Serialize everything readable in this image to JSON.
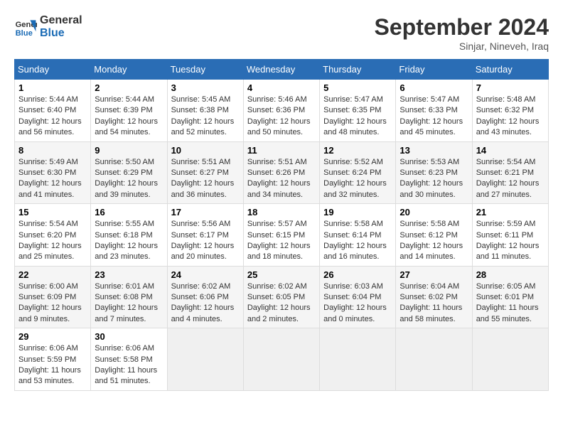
{
  "logo": {
    "line1": "General",
    "line2": "Blue"
  },
  "title": "September 2024",
  "location": "Sinjar, Nineveh, Iraq",
  "days_of_week": [
    "Sunday",
    "Monday",
    "Tuesday",
    "Wednesday",
    "Thursday",
    "Friday",
    "Saturday"
  ],
  "weeks": [
    [
      {
        "day": "1",
        "sunrise": "5:44 AM",
        "sunset": "6:40 PM",
        "daylight": "12 hours and 56 minutes."
      },
      {
        "day": "2",
        "sunrise": "5:44 AM",
        "sunset": "6:39 PM",
        "daylight": "12 hours and 54 minutes."
      },
      {
        "day": "3",
        "sunrise": "5:45 AM",
        "sunset": "6:38 PM",
        "daylight": "12 hours and 52 minutes."
      },
      {
        "day": "4",
        "sunrise": "5:46 AM",
        "sunset": "6:36 PM",
        "daylight": "12 hours and 50 minutes."
      },
      {
        "day": "5",
        "sunrise": "5:47 AM",
        "sunset": "6:35 PM",
        "daylight": "12 hours and 48 minutes."
      },
      {
        "day": "6",
        "sunrise": "5:47 AM",
        "sunset": "6:33 PM",
        "daylight": "12 hours and 45 minutes."
      },
      {
        "day": "7",
        "sunrise": "5:48 AM",
        "sunset": "6:32 PM",
        "daylight": "12 hours and 43 minutes."
      }
    ],
    [
      {
        "day": "8",
        "sunrise": "5:49 AM",
        "sunset": "6:30 PM",
        "daylight": "12 hours and 41 minutes."
      },
      {
        "day": "9",
        "sunrise": "5:50 AM",
        "sunset": "6:29 PM",
        "daylight": "12 hours and 39 minutes."
      },
      {
        "day": "10",
        "sunrise": "5:51 AM",
        "sunset": "6:27 PM",
        "daylight": "12 hours and 36 minutes."
      },
      {
        "day": "11",
        "sunrise": "5:51 AM",
        "sunset": "6:26 PM",
        "daylight": "12 hours and 34 minutes."
      },
      {
        "day": "12",
        "sunrise": "5:52 AM",
        "sunset": "6:24 PM",
        "daylight": "12 hours and 32 minutes."
      },
      {
        "day": "13",
        "sunrise": "5:53 AM",
        "sunset": "6:23 PM",
        "daylight": "12 hours and 30 minutes."
      },
      {
        "day": "14",
        "sunrise": "5:54 AM",
        "sunset": "6:21 PM",
        "daylight": "12 hours and 27 minutes."
      }
    ],
    [
      {
        "day": "15",
        "sunrise": "5:54 AM",
        "sunset": "6:20 PM",
        "daylight": "12 hours and 25 minutes."
      },
      {
        "day": "16",
        "sunrise": "5:55 AM",
        "sunset": "6:18 PM",
        "daylight": "12 hours and 23 minutes."
      },
      {
        "day": "17",
        "sunrise": "5:56 AM",
        "sunset": "6:17 PM",
        "daylight": "12 hours and 20 minutes."
      },
      {
        "day": "18",
        "sunrise": "5:57 AM",
        "sunset": "6:15 PM",
        "daylight": "12 hours and 18 minutes."
      },
      {
        "day": "19",
        "sunrise": "5:58 AM",
        "sunset": "6:14 PM",
        "daylight": "12 hours and 16 minutes."
      },
      {
        "day": "20",
        "sunrise": "5:58 AM",
        "sunset": "6:12 PM",
        "daylight": "12 hours and 14 minutes."
      },
      {
        "day": "21",
        "sunrise": "5:59 AM",
        "sunset": "6:11 PM",
        "daylight": "12 hours and 11 minutes."
      }
    ],
    [
      {
        "day": "22",
        "sunrise": "6:00 AM",
        "sunset": "6:09 PM",
        "daylight": "12 hours and 9 minutes."
      },
      {
        "day": "23",
        "sunrise": "6:01 AM",
        "sunset": "6:08 PM",
        "daylight": "12 hours and 7 minutes."
      },
      {
        "day": "24",
        "sunrise": "6:02 AM",
        "sunset": "6:06 PM",
        "daylight": "12 hours and 4 minutes."
      },
      {
        "day": "25",
        "sunrise": "6:02 AM",
        "sunset": "6:05 PM",
        "daylight": "12 hours and 2 minutes."
      },
      {
        "day": "26",
        "sunrise": "6:03 AM",
        "sunset": "6:04 PM",
        "daylight": "12 hours and 0 minutes."
      },
      {
        "day": "27",
        "sunrise": "6:04 AM",
        "sunset": "6:02 PM",
        "daylight": "11 hours and 58 minutes."
      },
      {
        "day": "28",
        "sunrise": "6:05 AM",
        "sunset": "6:01 PM",
        "daylight": "11 hours and 55 minutes."
      }
    ],
    [
      {
        "day": "29",
        "sunrise": "6:06 AM",
        "sunset": "5:59 PM",
        "daylight": "11 hours and 53 minutes."
      },
      {
        "day": "30",
        "sunrise": "6:06 AM",
        "sunset": "5:58 PM",
        "daylight": "11 hours and 51 minutes."
      },
      null,
      null,
      null,
      null,
      null
    ]
  ],
  "labels": {
    "sunrise": "Sunrise:",
    "sunset": "Sunset:",
    "daylight": "Daylight:"
  }
}
